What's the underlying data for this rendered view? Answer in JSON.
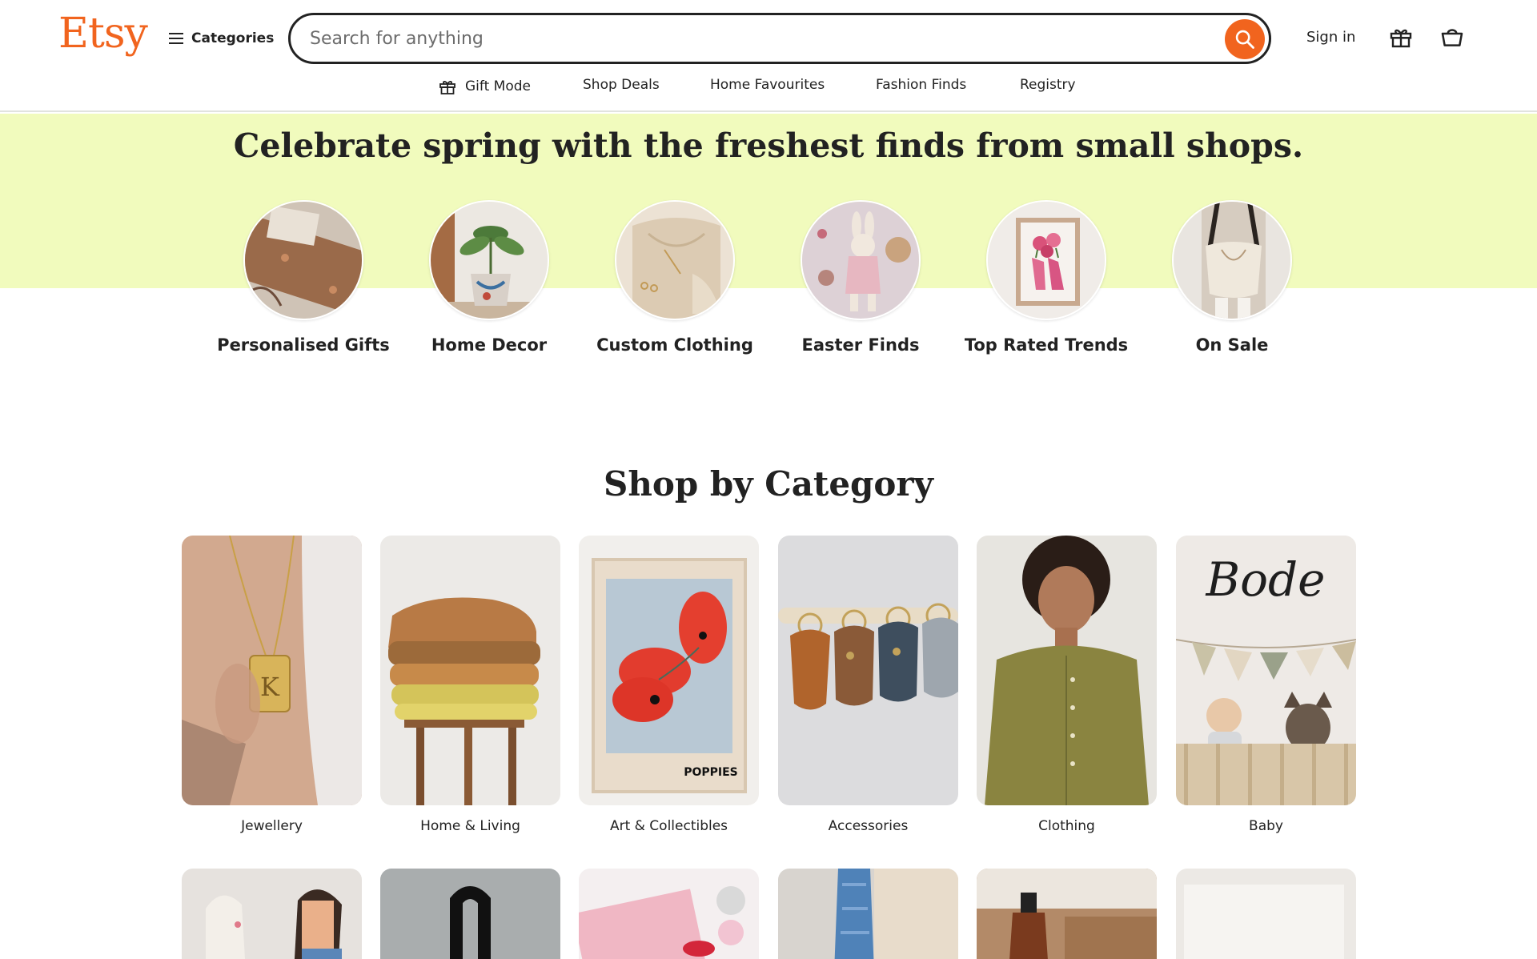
{
  "header": {
    "logo": "Etsy",
    "categories_label": "Categories",
    "search_placeholder": "Search for anything",
    "signin_label": "Sign in"
  },
  "nav": {
    "items": [
      {
        "label": "Gift Mode",
        "icon": "gift-icon"
      },
      {
        "label": "Shop Deals"
      },
      {
        "label": "Home Favourites"
      },
      {
        "label": "Fashion Finds"
      },
      {
        "label": "Registry"
      }
    ]
  },
  "hero": {
    "title": "Celebrate spring with the freshest finds from small shops.",
    "circles": [
      {
        "label": "Personalised Gifts"
      },
      {
        "label": "Home Decor"
      },
      {
        "label": "Custom Clothing"
      },
      {
        "label": "Easter Finds"
      },
      {
        "label": "Top Rated Trends"
      },
      {
        "label": "On Sale"
      }
    ]
  },
  "shop_by_category": {
    "title": "Shop by Category",
    "categories": [
      {
        "label": "Jewellery"
      },
      {
        "label": "Home & Living"
      },
      {
        "label": "Art & Collectibles"
      },
      {
        "label": "Accessories"
      },
      {
        "label": "Clothing"
      },
      {
        "label": "Baby"
      }
    ],
    "art_print_text": "POPPIES",
    "baby_sign_text": "Bode"
  },
  "colors": {
    "brand": "#f1641e",
    "hero_band": "#f1fbbd",
    "text": "#222222"
  }
}
